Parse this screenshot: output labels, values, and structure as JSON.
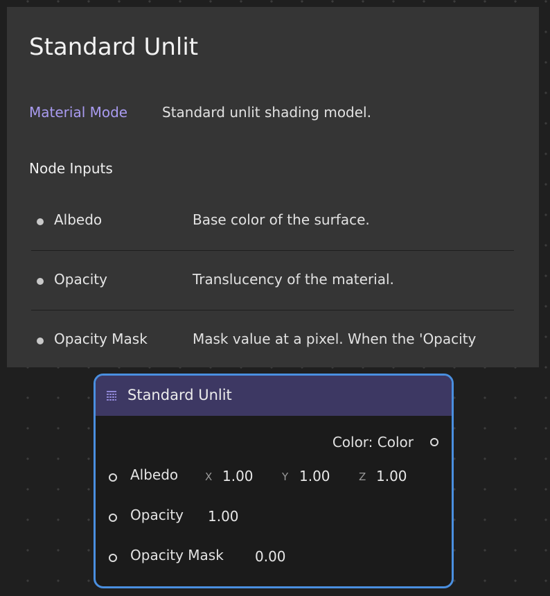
{
  "tooltip": {
    "title": "Standard Unlit",
    "mode_label": "Material Mode",
    "mode_description": "Standard unlit shading model.",
    "inputs_heading": "Node Inputs",
    "inputs": [
      {
        "name": "Albedo",
        "description": "Base color of the surface."
      },
      {
        "name": "Opacity",
        "description": "Translucency of the material."
      },
      {
        "name": "Opacity Mask",
        "description": "Mask value at a pixel. When the 'Opacity"
      }
    ]
  },
  "node": {
    "title": "Standard Unlit",
    "icon": "grid-node-icon",
    "output_label": "Color: Color",
    "inputs": {
      "albedo": {
        "label": "Albedo",
        "x_axis": "X",
        "x_value": "1.00",
        "y_axis": "Y",
        "y_value": "1.00",
        "z_axis": "Z",
        "z_value": "1.00"
      },
      "opacity": {
        "label": "Opacity",
        "value": "1.00"
      },
      "opacity_mask": {
        "label": "Opacity Mask",
        "value": "0.00"
      }
    }
  },
  "colors": {
    "canvas": "#1f1f1f",
    "tooltip_bg": "#353535",
    "accent_purple": "#a99bf0",
    "node_header": "#3d3863",
    "node_selected_border": "#4a8fe0"
  }
}
